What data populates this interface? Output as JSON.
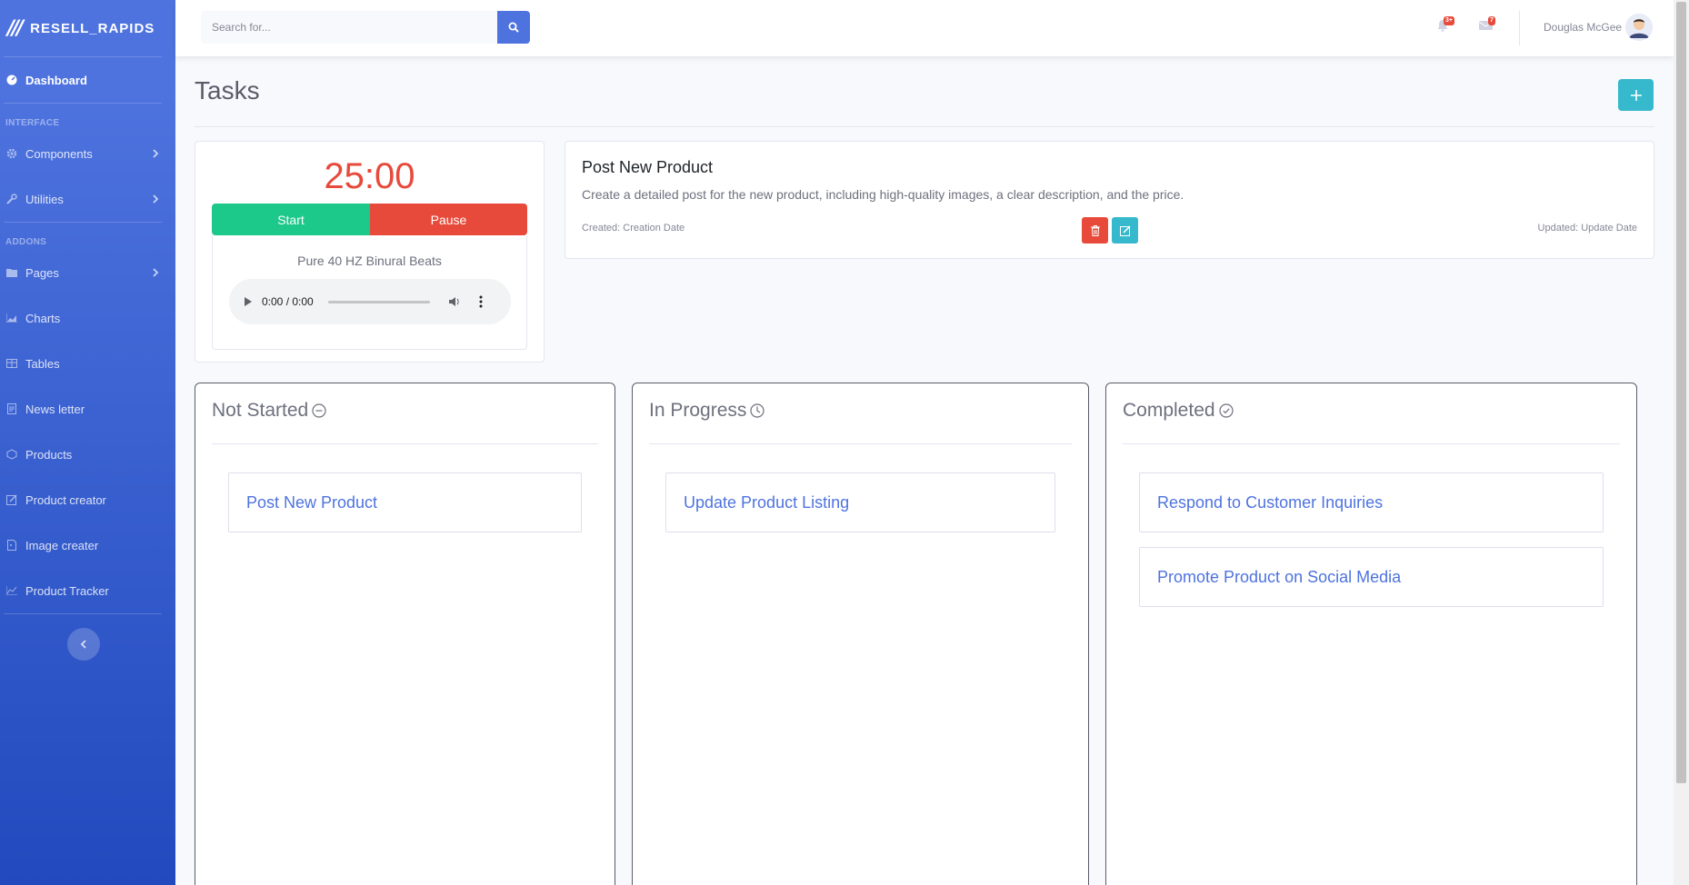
{
  "brand": {
    "logo": "///",
    "name": "RESELL_RAPIDS"
  },
  "sidebar": {
    "dashboard": "Dashboard",
    "heading_interface": "INTERFACE",
    "heading_addons": "ADDONS",
    "items": [
      {
        "label": "Components",
        "icon": "gear-icon"
      },
      {
        "label": "Utilities",
        "icon": "wrench-icon"
      },
      {
        "label": "Pages",
        "icon": "folder-icon"
      },
      {
        "label": "Charts",
        "icon": "chart-area-icon"
      },
      {
        "label": "Tables",
        "icon": "table-icon"
      },
      {
        "label": "News letter",
        "icon": "newspaper-icon"
      },
      {
        "label": "Products",
        "icon": "cube-icon"
      },
      {
        "label": "Product creator",
        "icon": "edit-icon"
      },
      {
        "label": "Image creater",
        "icon": "image-icon"
      },
      {
        "label": "Product Tracker",
        "icon": "line-chart-icon"
      }
    ]
  },
  "topbar": {
    "search_placeholder": "Search for...",
    "alerts_badge": "3+",
    "messages_badge": "7",
    "user_name": "Douglas McGee"
  },
  "page": {
    "title": "Tasks"
  },
  "timer": {
    "display": "25:00",
    "start_label": "Start",
    "pause_label": "Pause",
    "audio_title": "Pure 40 HZ Binural Beats",
    "audio_time": "0:00 / 0:00"
  },
  "task": {
    "title": "Post New Product",
    "description": "Create a detailed post for the new product, including high-quality images, a clear description, and the price.",
    "created": "Created: Creation Date",
    "updated": "Updated: Update Date"
  },
  "columns": [
    {
      "title": "Not Started",
      "icon": "minus-circle-icon",
      "items": [
        "Post New Product"
      ]
    },
    {
      "title": "In Progress",
      "icon": "clock-icon",
      "items": [
        "Update Product Listing"
      ]
    },
    {
      "title": "Completed",
      "icon": "check-circle-icon",
      "items": [
        "Respond to Customer Inquiries",
        "Promote Product on Social Media"
      ]
    }
  ],
  "colors": {
    "primary": "#4e73df",
    "success": "#1cc88a",
    "danger": "#e74a3b",
    "info": "#36b9cc"
  }
}
